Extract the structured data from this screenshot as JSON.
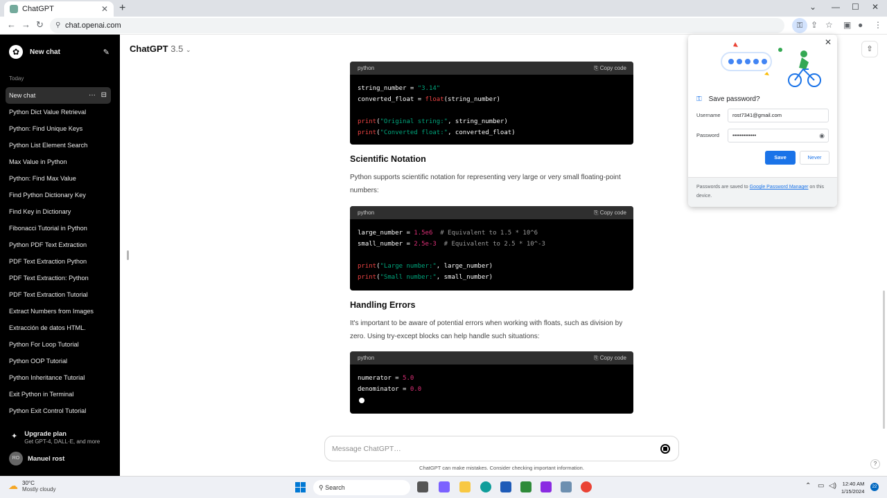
{
  "browser": {
    "tab_title": "ChatGPT",
    "tab_close": "✕",
    "new_tab": "+",
    "url": "chat.openai.com",
    "controls": {
      "dropdown": "⌄",
      "minimize": "—",
      "maximize": "☐",
      "close": "✕"
    }
  },
  "sidebar": {
    "new_chat": "New chat",
    "section_today": "Today",
    "history": [
      "New chat",
      "Python Dict Value Retrieval",
      "Python: Find Unique Keys",
      "Python List Element Search",
      "Max Value in Python",
      "Python: Find Max Value",
      "Find Python Dictionary Key",
      "Find Key in Dictionary",
      "Fibonacci Tutorial in Python",
      "Python PDF Text Extraction",
      "PDF Text Extraction Python",
      "PDF Text Extraction: Python",
      "PDF Text Extraction Tutorial",
      "Extract Numbers from Images",
      "Extracción de datos HTML.",
      "Python For Loop Tutorial",
      "Python OOP Tutorial",
      "Python Inheritance Tutorial",
      "Exit Python in Terminal",
      "Python Exit Control Tutorial"
    ],
    "upgrade_title": "Upgrade plan",
    "upgrade_sub": "Get GPT-4, DALL·E, and more",
    "user_initials": "RO",
    "user_name": "Manuel rost"
  },
  "main": {
    "model_name": "ChatGPT",
    "model_version": "3.5",
    "code_lang": "python",
    "copy_label": "Copy code",
    "heading_scientific": "Scientific Notation",
    "para_scientific": "Python supports scientific notation for representing very large or very small floating-point numbers:",
    "heading_errors": "Handling Errors",
    "para_errors": "It's important to be aware of potential errors when working with floats, such as division by zero. Using try-except blocks can help handle such situations:",
    "composer_placeholder": "Message ChatGPT…",
    "disclaimer": "ChatGPT can make mistakes. Consider checking important information.",
    "help": "?"
  },
  "password_popup": {
    "title": "Save password?",
    "username_label": "Username",
    "username_value": "rost7341@gmail.com",
    "password_label": "Password",
    "password_value": "•••••••••••••",
    "save_label": "Save",
    "never_label": "Never",
    "footer_prefix": "Passwords are saved to ",
    "footer_link": "Google Password Manager",
    "footer_suffix": " on this device."
  },
  "taskbar": {
    "temp": "30°C",
    "weather": "Mostly cloudy",
    "search": "Search",
    "time": "12:40 AM",
    "date": "1/15/2024",
    "notifications": "22"
  },
  "colors": {
    "accent": "#1a73e8",
    "code_bg": "#000000",
    "code_header": "#2f2f2f",
    "sidebar_bg": "#000000"
  }
}
